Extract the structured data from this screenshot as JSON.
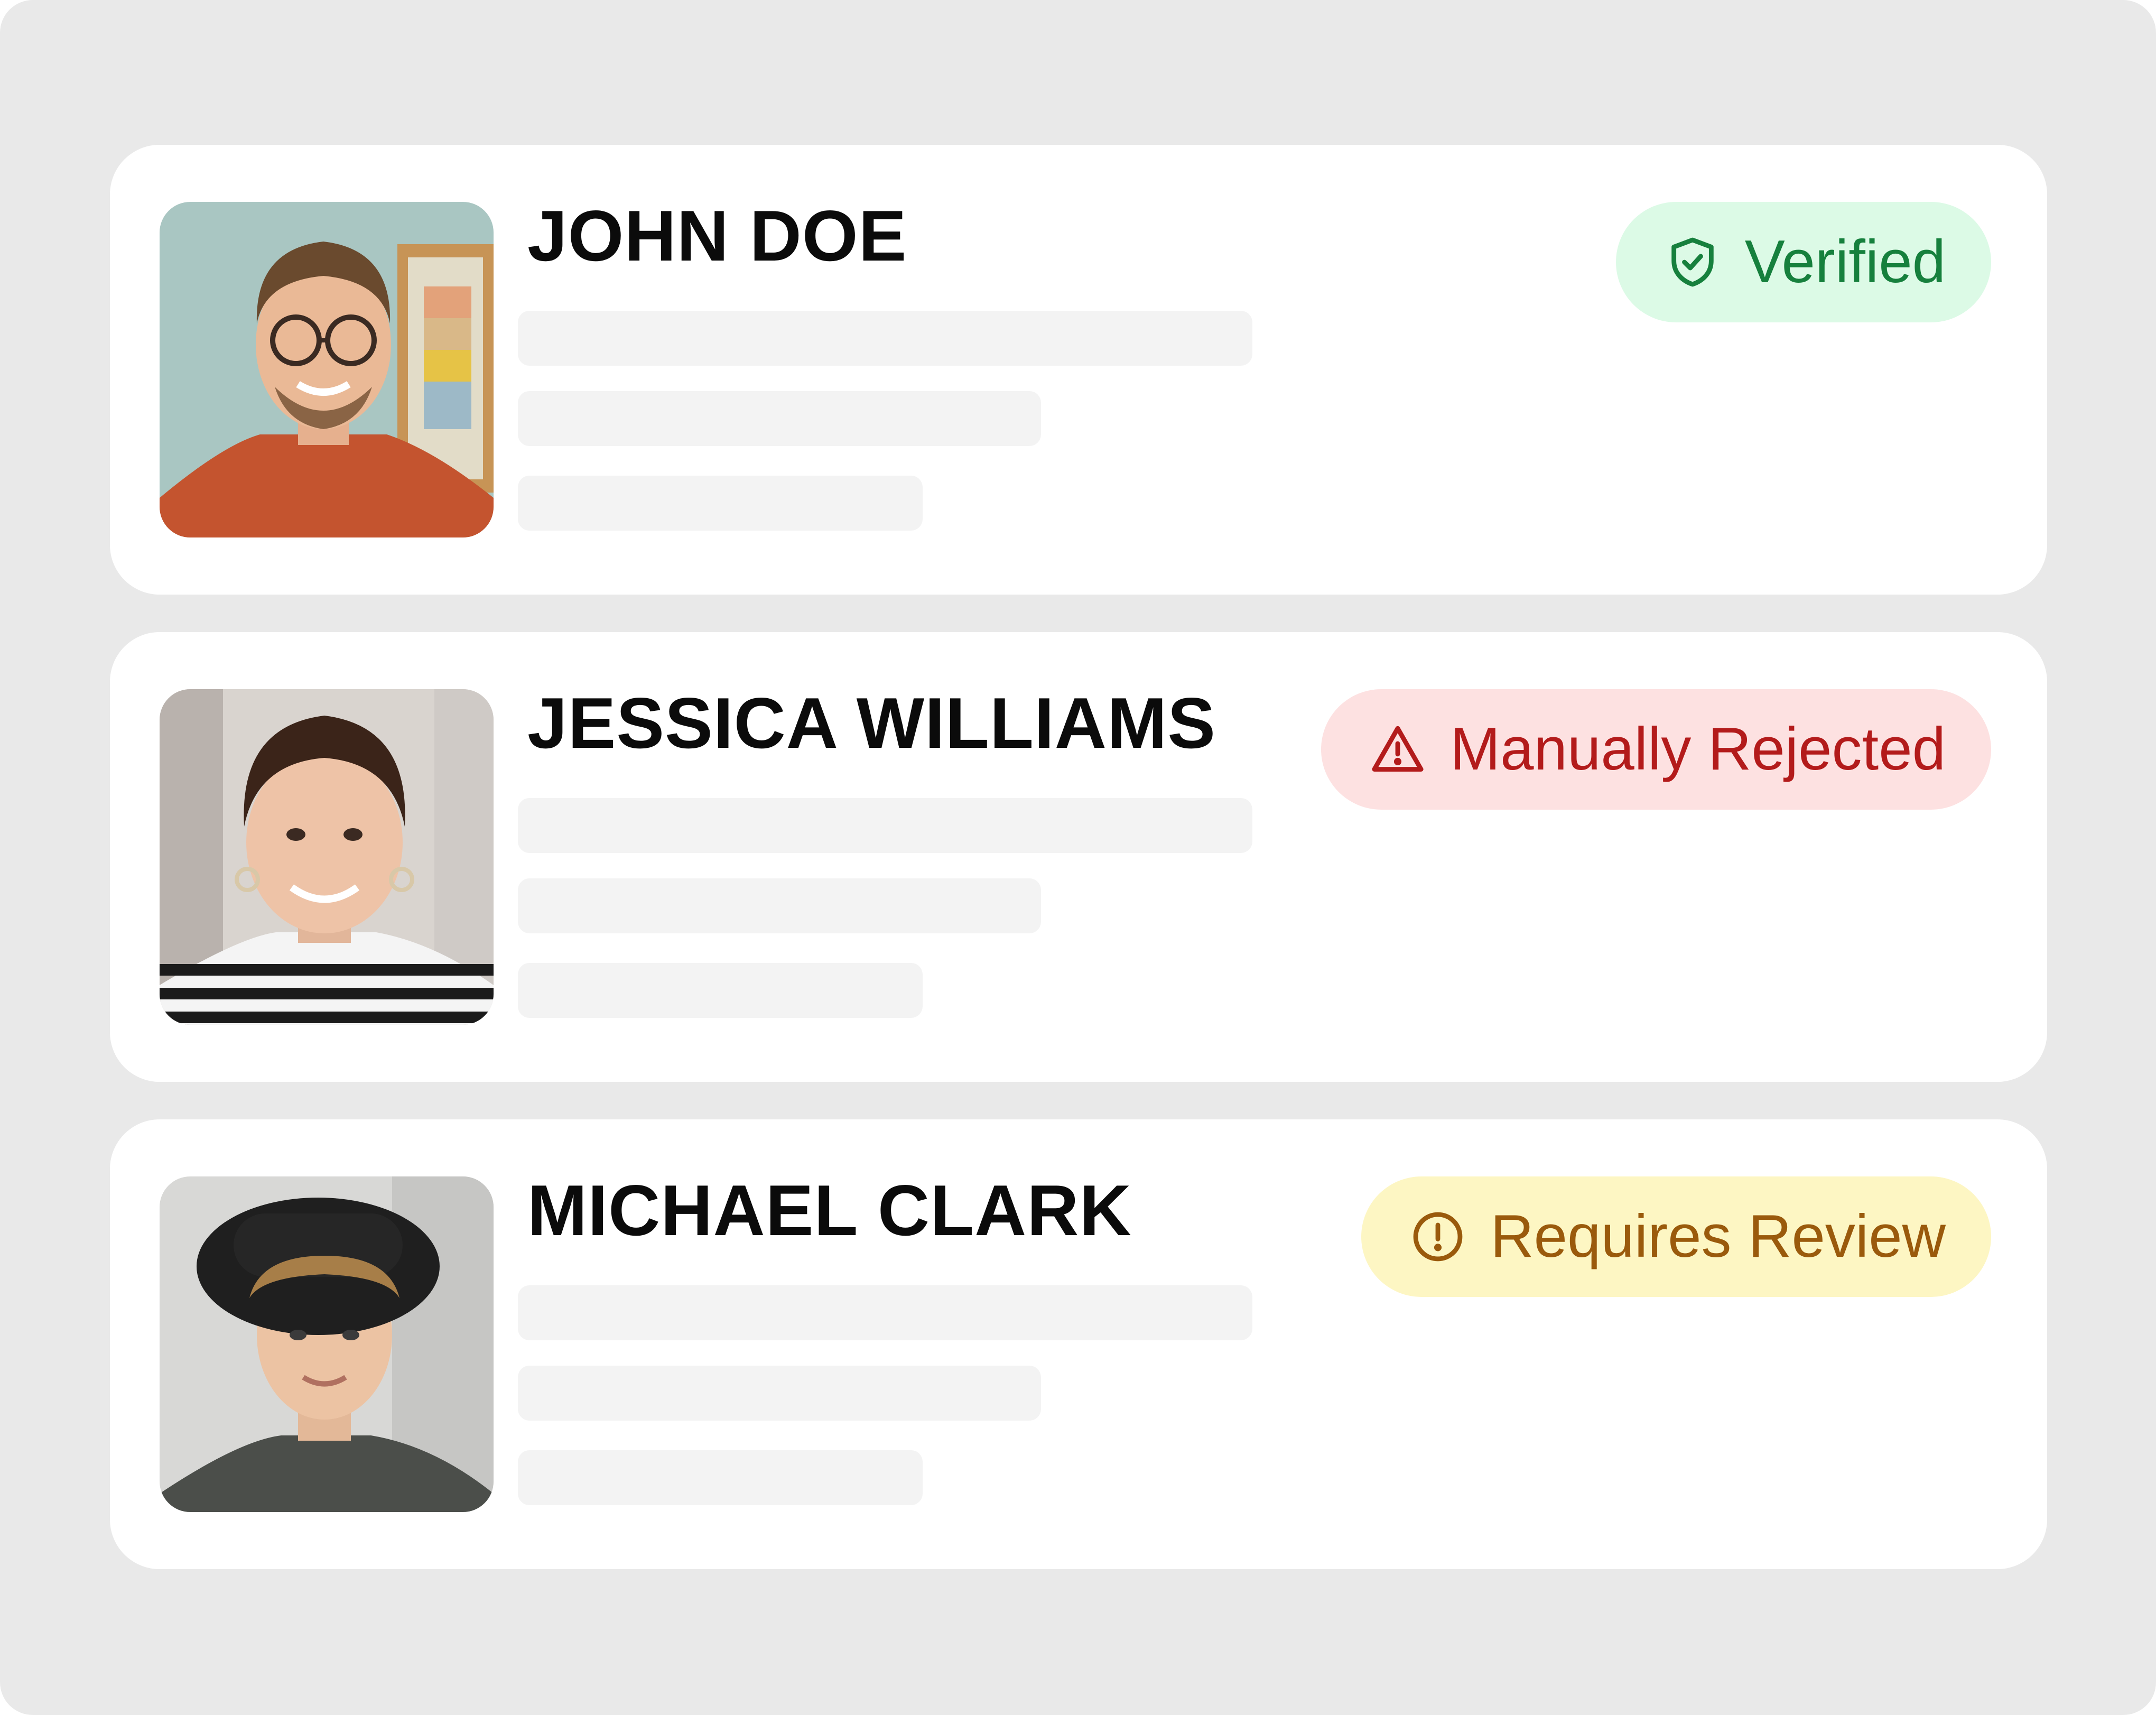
{
  "users": [
    {
      "name": "JOHN DOE",
      "status": "Verified",
      "status_icon": "shield-check-icon",
      "status_color": "#16803d",
      "status_bg": "#dcfae6"
    },
    {
      "name": "JESSICA WILLIAMS",
      "status": "Manually Rejected",
      "status_icon": "warning-triangle-icon",
      "status_color": "#b31b1b",
      "status_bg": "#fde1e1"
    },
    {
      "name": "MICHAEL CLARK",
      "status": "Requires Review",
      "status_icon": "exclamation-circle-icon",
      "status_color": "#9a5a0c",
      "status_bg": "#fdf6c3"
    }
  ]
}
